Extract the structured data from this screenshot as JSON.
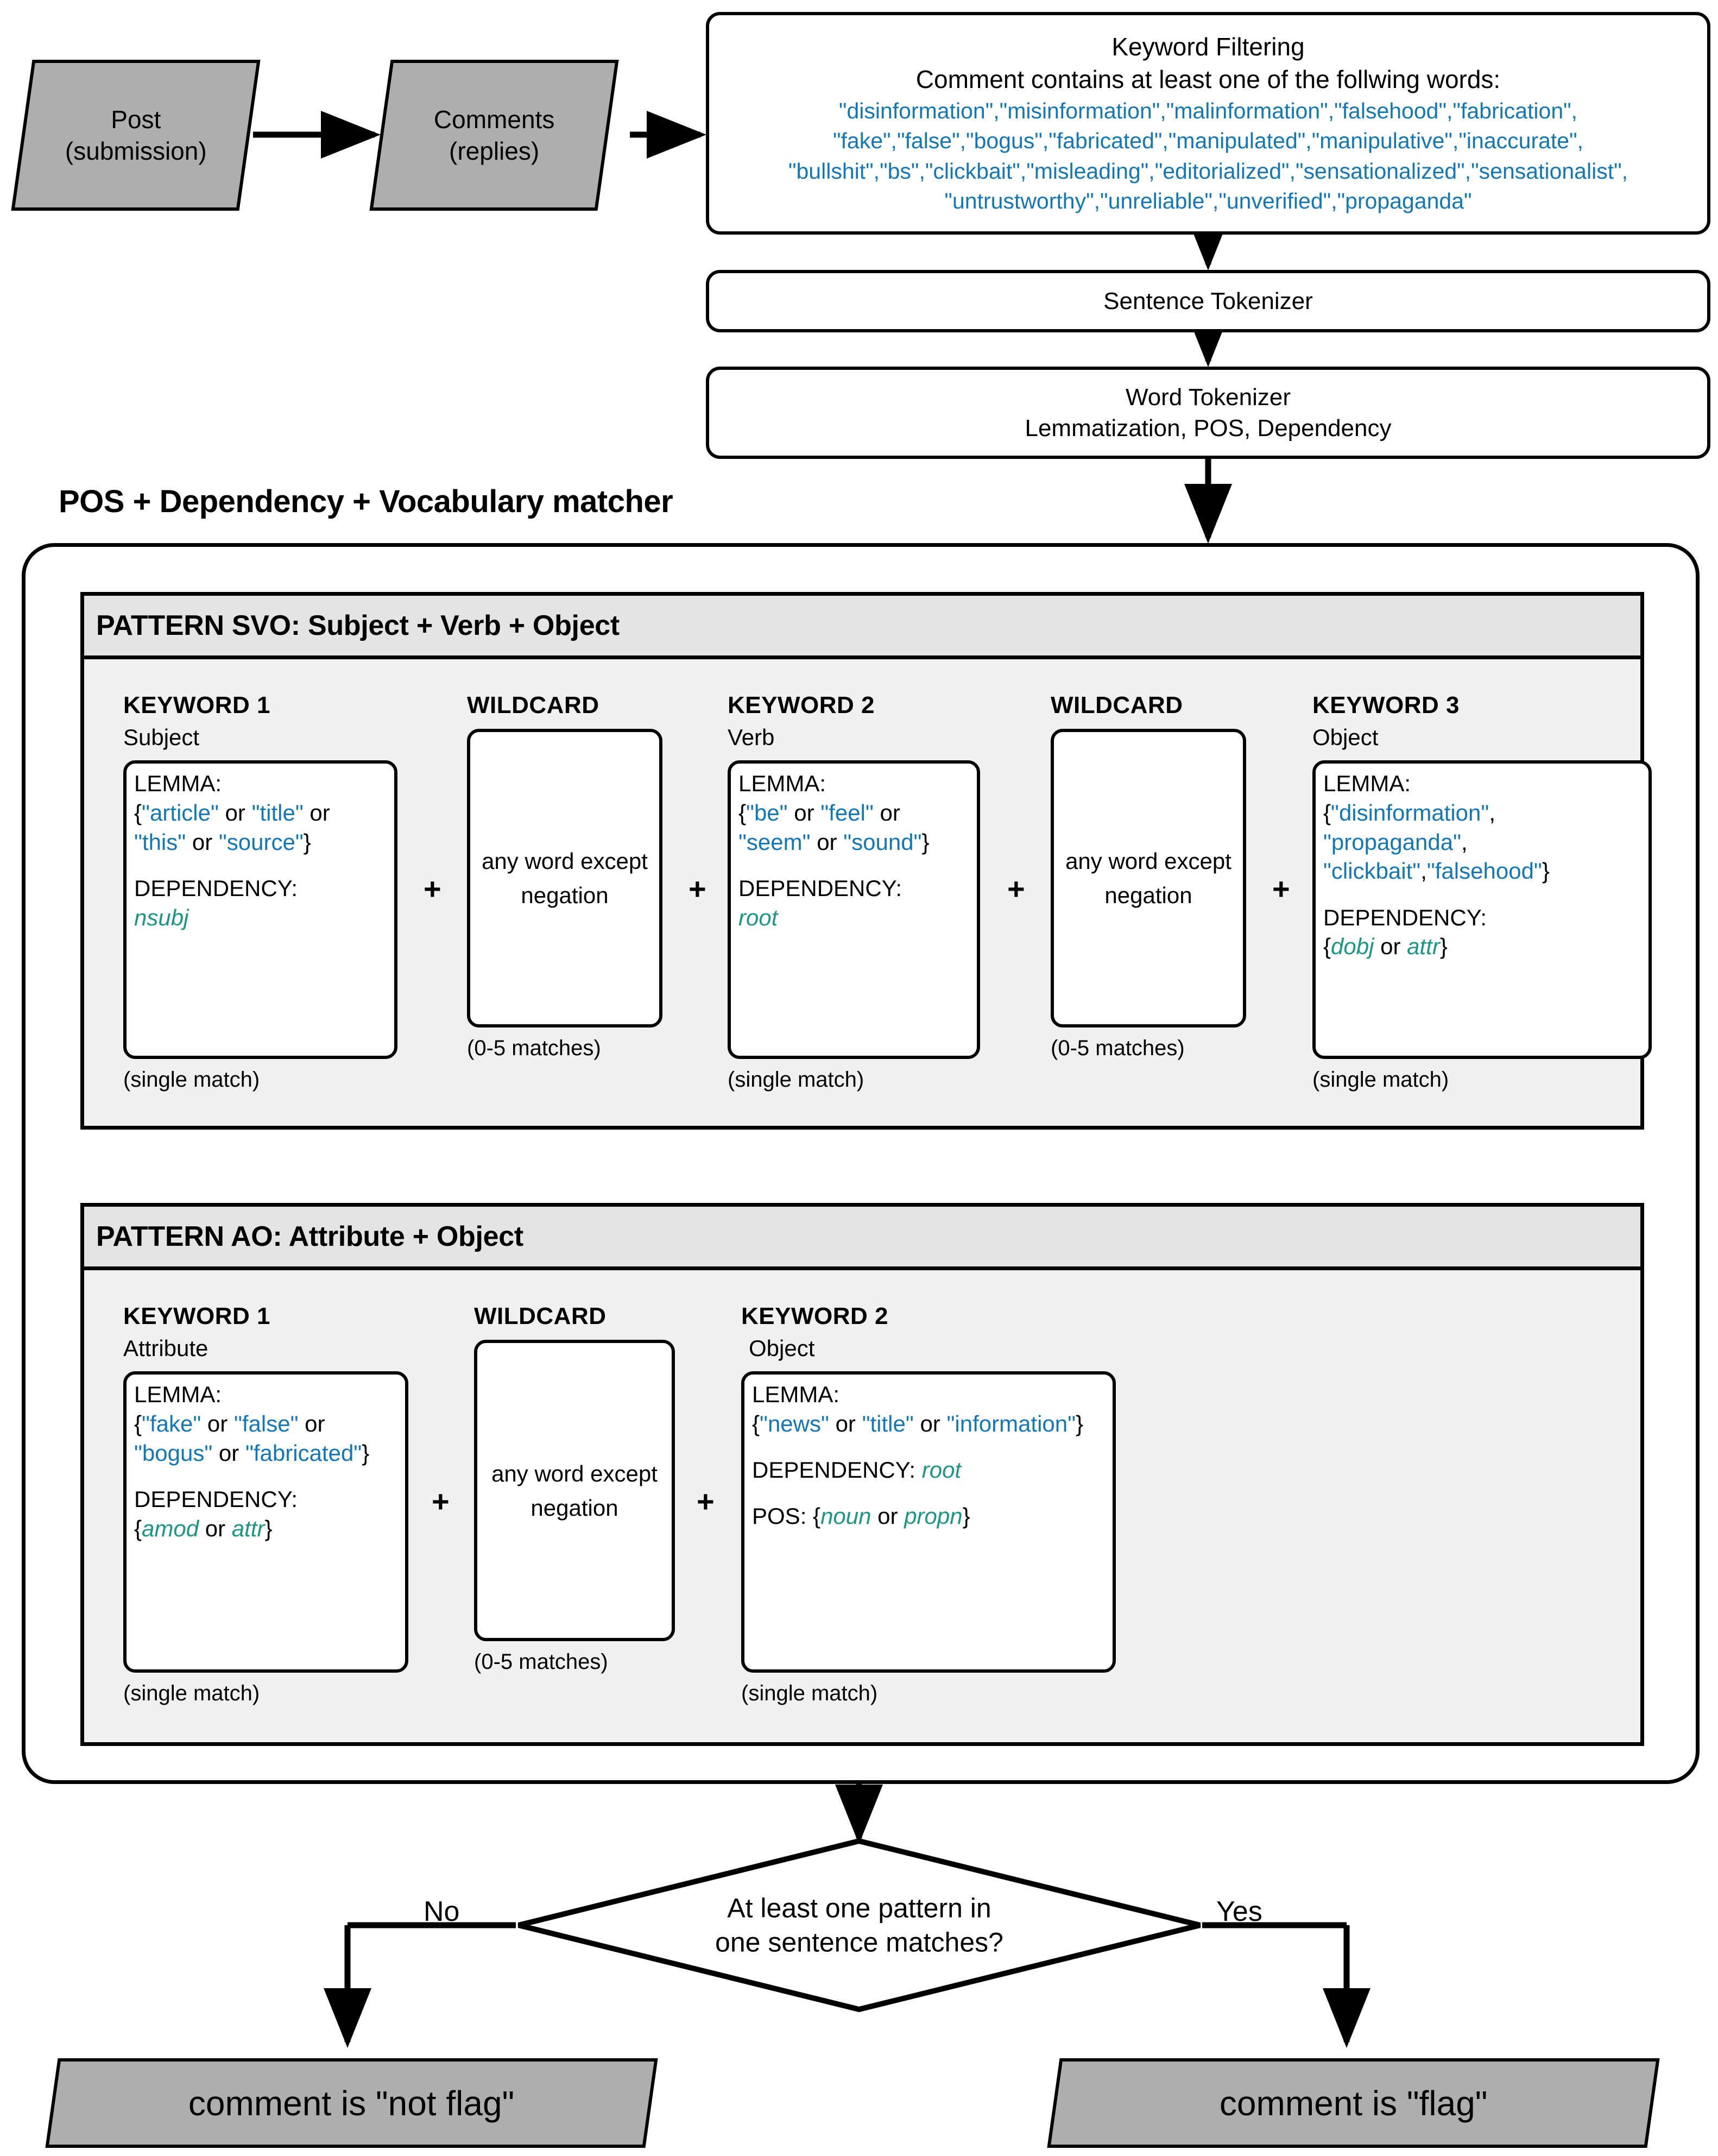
{
  "diagram": {
    "title": "Comment disinformation-flagging pipeline",
    "colors": {
      "keyword_blue": "#1277b8",
      "dependency_teal": "#1b9680",
      "terminator_gray": "#aeaeae",
      "panel_gray": "#f0f0f0",
      "panel_header_gray": "#e4e4e4"
    }
  },
  "nodes": {
    "post": {
      "line1": "Post",
      "line2": "(submission)"
    },
    "comments": {
      "line1": "Comments",
      "line2": "(replies)"
    },
    "keyword_filtering": {
      "title": "Keyword Filtering",
      "subtitle": "Comment contains at least one of the follwing words:",
      "words_lines": [
        "\"disinformation\",\"misinformation\",\"malinformation\",\"falsehood\",\"fabrication\",",
        "\"fake\",\"false\",\"bogus\",\"fabricated\",\"manipulated\",\"manipulative\",\"inaccurate\",",
        "\"bullshit\",\"bs\",\"clickbait\",\"misleading\",\"editorialized\",\"sensationalized\",\"sensationalist\",",
        "\"untrustworthy\",\"unreliable\",\"unverified\",\"propaganda\""
      ],
      "words": [
        "disinformation",
        "misinformation",
        "malinformation",
        "falsehood",
        "fabrication",
        "fake",
        "false",
        "bogus",
        "fabricated",
        "manipulated",
        "manipulative",
        "inaccurate",
        "bullshit",
        "bs",
        "clickbait",
        "misleading",
        "editorialized",
        "sensationalized",
        "sensationalist",
        "untrustworthy",
        "unreliable",
        "unverified",
        "propaganda"
      ]
    },
    "sentence_tokenizer": {
      "label": "Sentence Tokenizer"
    },
    "word_tokenizer": {
      "line1": "Word Tokenizer",
      "line2": "Lemmatization, POS, Dependency"
    },
    "matcher_title": "POS + Dependency + Vocabulary matcher",
    "decision": {
      "line1": "At least one pattern in",
      "line2": "one sentence matches?",
      "no_label": "No",
      "yes_label": "Yes"
    },
    "not_flag": {
      "label": "comment is \"not flag\""
    },
    "flag": {
      "label": "comment is \"flag\""
    }
  },
  "patterns": [
    {
      "header": "PATTERN SVO: Subject + Verb + Object",
      "columns": [
        {
          "kind": "keyword",
          "title": "KEYWORD 1",
          "subtitle": "Subject",
          "footer": "(single match)",
          "lemma_label": "LEMMA:",
          "lemma_text": "{\"article\" or \"title\" or \"this\" or \"source\"}",
          "lemma_values": [
            "article",
            "title",
            "this",
            "source"
          ],
          "dependency_label": "DEPENDENCY:",
          "dependency_text": "nsubj",
          "dependency_values": [
            "nsubj"
          ]
        },
        {
          "kind": "wildcard",
          "title": "WILDCARD",
          "subtitle": "",
          "footer": "(0-5 matches)",
          "body": "any word except negation"
        },
        {
          "kind": "keyword",
          "title": "KEYWORD 2",
          "subtitle": "Verb",
          "footer": "(single match)",
          "lemma_label": "LEMMA:",
          "lemma_text": "{\"be\" or \"feel\" or \"seem\" or \"sound\"}",
          "lemma_values": [
            "be",
            "feel",
            "seem",
            "sound"
          ],
          "dependency_label": "DEPENDENCY:",
          "dependency_text": "root",
          "dependency_values": [
            "root"
          ]
        },
        {
          "kind": "wildcard",
          "title": "WILDCARD",
          "subtitle": "",
          "footer": "(0-5 matches)",
          "body": "any word except negation"
        },
        {
          "kind": "keyword",
          "title": "KEYWORD 3",
          "subtitle": "Object",
          "footer": "(single match)",
          "lemma_label": "LEMMA:",
          "lemma_text": "{\"disinformation\", \"propaganda\", \"clickbait\",\"falsehood\"}",
          "lemma_values": [
            "disinformation",
            "propaganda",
            "clickbait",
            "falsehood"
          ],
          "dependency_label": "DEPENDENCY:",
          "dependency_text": "{dobj or attr}",
          "dependency_values": [
            "dobj",
            "attr"
          ]
        }
      ]
    },
    {
      "header": "PATTERN AO: Attribute + Object",
      "columns": [
        {
          "kind": "keyword",
          "title": "KEYWORD 1",
          "subtitle": "Attribute",
          "footer": "(single match)",
          "lemma_label": "LEMMA:",
          "lemma_text": "{\"fake\" or \"false\" or \"bogus\" or \"fabricated\"}",
          "lemma_values": [
            "fake",
            "false",
            "bogus",
            "fabricated"
          ],
          "dependency_label": "DEPENDENCY:",
          "dependency_text": "{amod or attr}",
          "dependency_values": [
            "amod",
            "attr"
          ]
        },
        {
          "kind": "wildcard",
          "title": "WILDCARD",
          "subtitle": "",
          "footer": "(0-5 matches)",
          "body": "any word except negation"
        },
        {
          "kind": "keyword",
          "title": "KEYWORD 2",
          "subtitle": "Object",
          "footer": "(single match)",
          "lemma_label": "LEMMA:",
          "lemma_text": "{\"news\" or \"title\" or \"information\"}",
          "lemma_values": [
            "news",
            "title",
            "information"
          ],
          "dependency_label": "DEPENDENCY:",
          "dependency_text": "root",
          "dependency_values": [
            "root"
          ],
          "pos_label": "POS:",
          "pos_text": "{noun or propn}",
          "pos_values": [
            "noun",
            "propn"
          ]
        }
      ]
    }
  ],
  "operators": {
    "plus": "+"
  }
}
